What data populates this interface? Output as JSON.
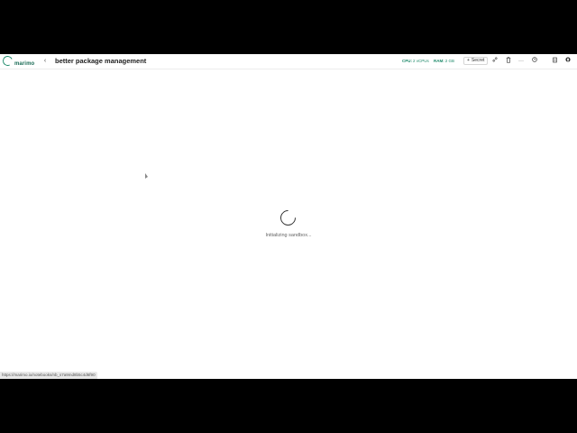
{
  "header": {
    "logo_text": "marimo",
    "back_symbol": "‹",
    "notebook_title": "better package management",
    "cpu_label": "CPU:",
    "cpu_value": "2 vCPUs",
    "ram_label": "RAM:",
    "ram_value": "2 GB",
    "secret_plus": "+",
    "secret_label": "Secret",
    "icons": {
      "link": "🔗",
      "trash": "🗑",
      "more": "···",
      "history": "◷",
      "document": "▯",
      "github": "⬤"
    }
  },
  "main": {
    "loading_text": "Initializing sandbox..."
  },
  "status_bar": {
    "url": "https://marimo.io/notebooks/nb_s7a9md8b5c4d6f90"
  },
  "colors": {
    "accent": "#1f8a6b",
    "letterbox": "#000000",
    "background": "#ffffff"
  }
}
